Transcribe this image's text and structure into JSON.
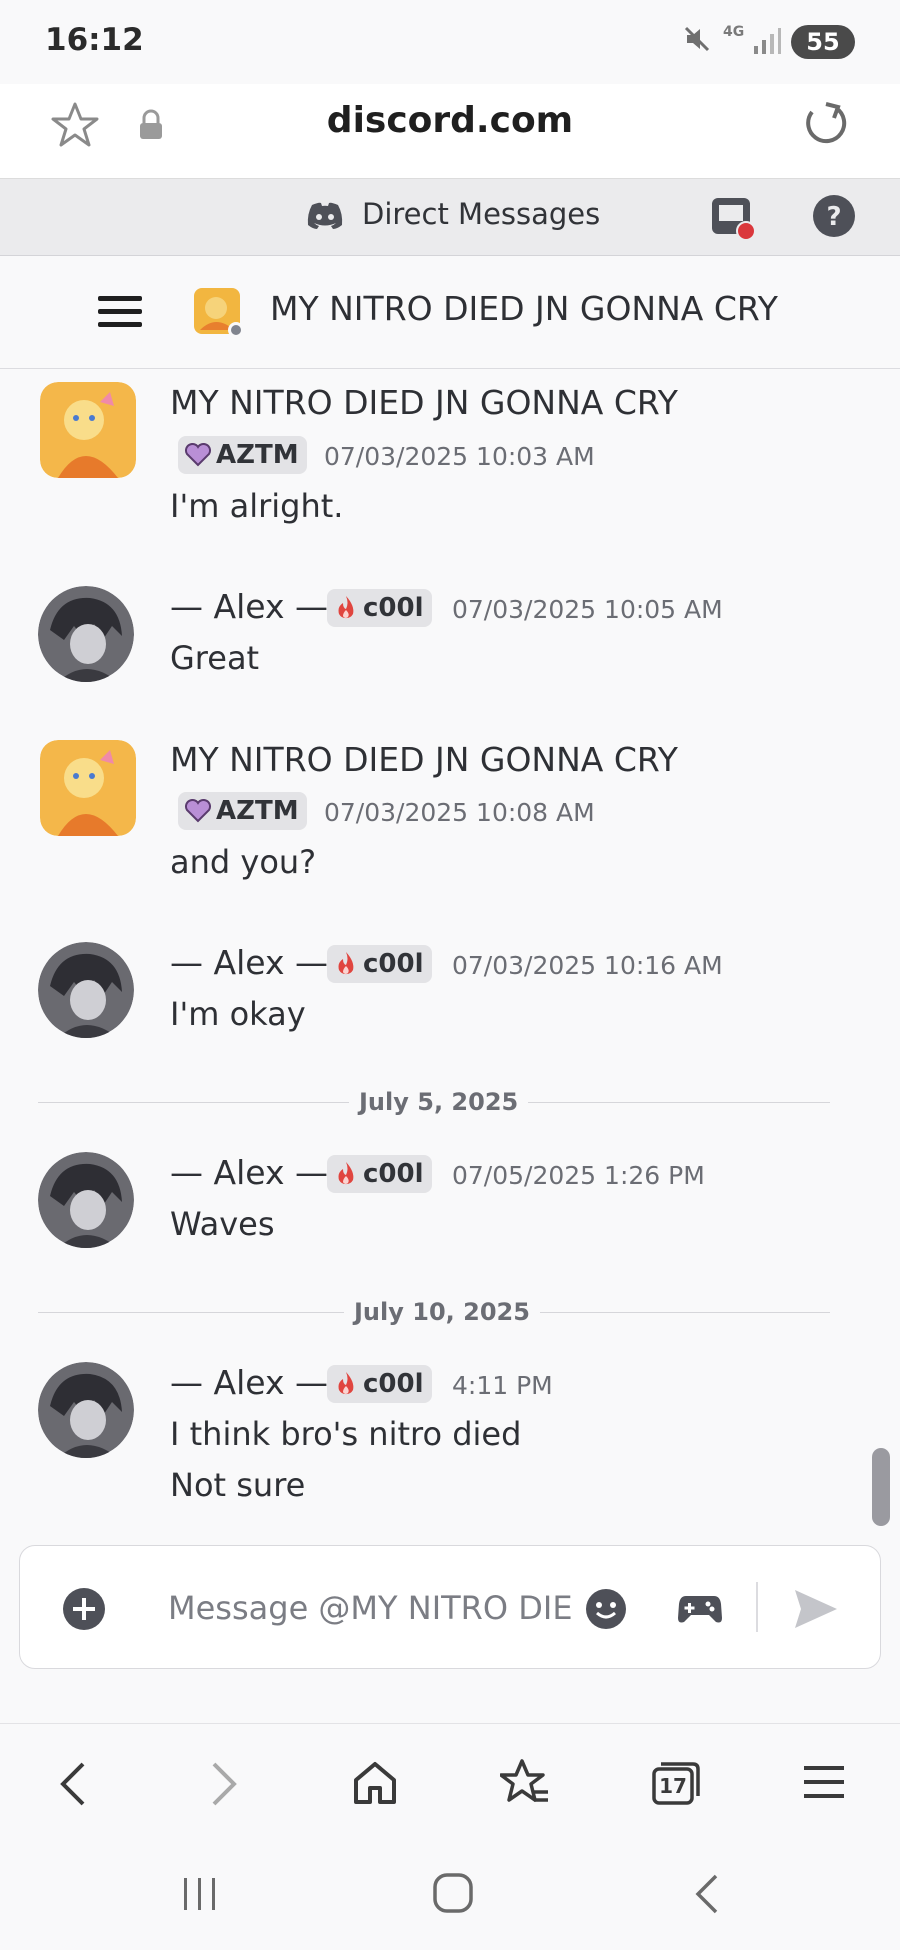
{
  "status_bar": {
    "time": "16:12",
    "network": "4G",
    "battery": "55",
    "icons": [
      "mute-icon",
      "signal-icon",
      "battery-icon"
    ]
  },
  "browser": {
    "url": "discord.com",
    "icons": [
      "star-icon",
      "lock-icon",
      "reload-icon"
    ]
  },
  "dm_header": {
    "title": "Direct Messages",
    "icons": [
      "discord-logo-icon",
      "inbox-icon",
      "help-icon"
    ]
  },
  "channel": {
    "name": "MY NITRO DIED JN GONNA CRY",
    "icons": [
      "menu-icon",
      "avatar"
    ]
  },
  "messages": [
    {
      "author": "MY NITRO DIED JN GONNA CRY",
      "tag": "AZTM",
      "timestamp": "07/03/2025 10:03 AM",
      "lines": [
        "I'm alright."
      ]
    },
    {
      "author": "— Alex —",
      "tag": "c00l",
      "timestamp": "07/03/2025 10:05 AM",
      "lines": [
        "Great"
      ]
    },
    {
      "author": "MY NITRO DIED JN GONNA CRY",
      "tag": "AZTM",
      "timestamp": "07/03/2025 10:08 AM",
      "lines": [
        "and you?"
      ]
    },
    {
      "author": "— Alex —",
      "tag": "c00l",
      "timestamp": "07/03/2025 10:16 AM",
      "lines": [
        "I'm okay"
      ]
    },
    {
      "author": "— Alex —",
      "tag": "c00l",
      "timestamp": "07/05/2025 1:26 PM",
      "lines": [
        "Waves"
      ]
    },
    {
      "author": "— Alex —",
      "tag": "c00l",
      "timestamp": "4:11 PM",
      "lines": [
        "I think bro's nitro died",
        "Not sure"
      ]
    }
  ],
  "date_dividers": [
    "July 5, 2025",
    "July 10, 2025"
  ],
  "composer": {
    "placeholder": "Message @MY NITRO DIED JN GONNA CRY",
    "icons": [
      "add-icon",
      "emoji-icon",
      "gamepad-icon",
      "send-icon"
    ]
  },
  "browser_nav": {
    "tab_count": "17",
    "icons": [
      "back-icon",
      "forward-icon",
      "home-icon",
      "bookmarks-icon",
      "tabs-icon",
      "menu-icon"
    ]
  },
  "system_nav": {
    "icons": [
      "recents-icon",
      "home-icon",
      "back-icon"
    ]
  },
  "colors": {
    "background": "#f9f9fa",
    "aztm_tag_heart": "#b98fd6",
    "c00l_tag_flame": "#e0453f",
    "notification_dot": "#da373c"
  }
}
